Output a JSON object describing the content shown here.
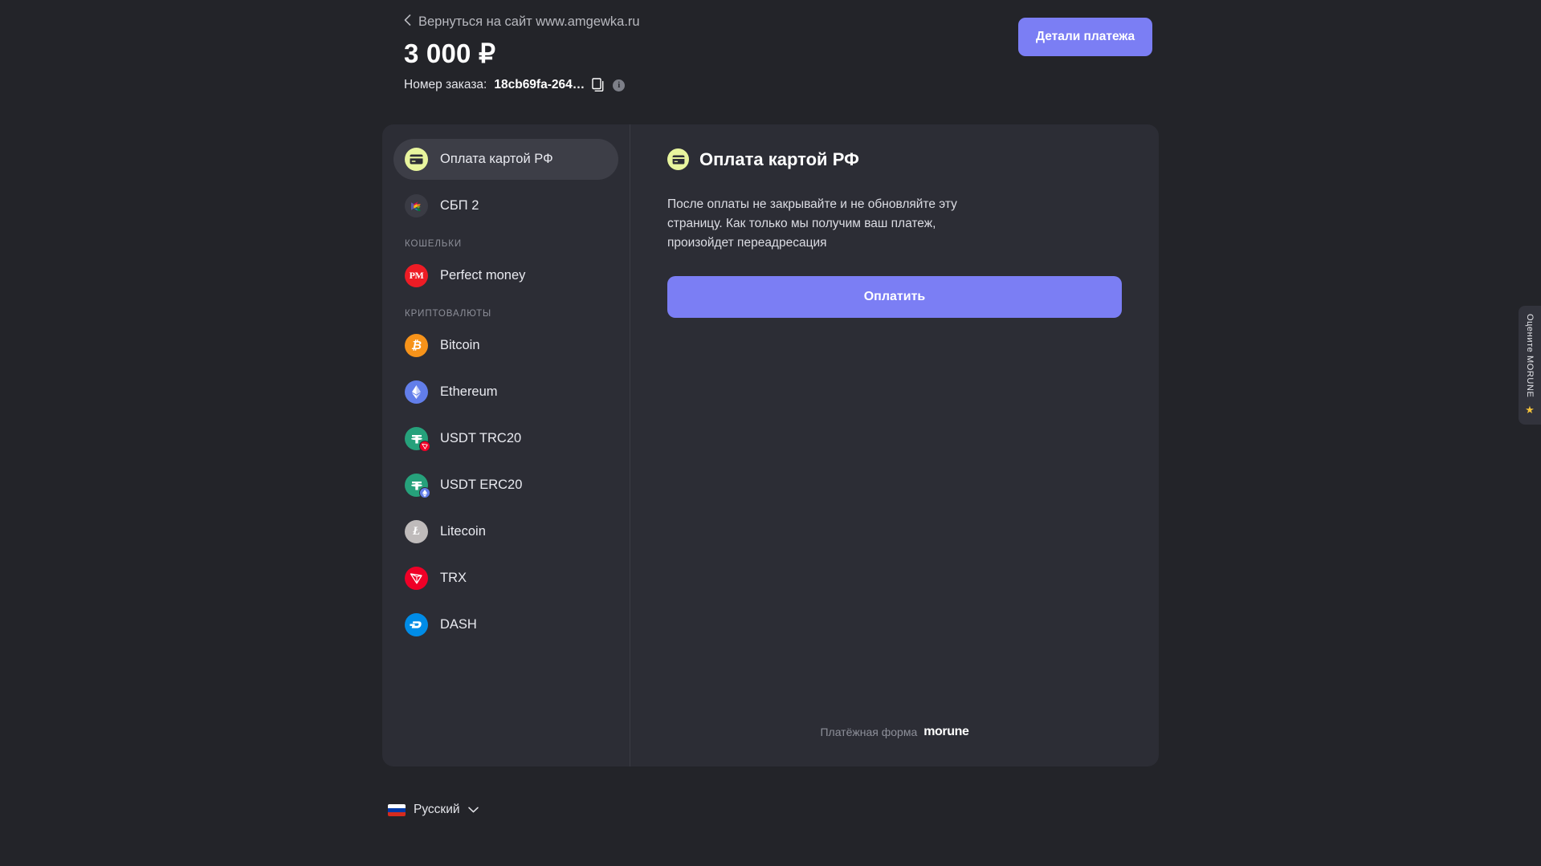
{
  "header": {
    "back_label": "Вернуться на сайт www.amgewka.ru",
    "amount": "3 000 ₽",
    "order_label": "Номер заказа:",
    "order_id": "18cb69fa-264…",
    "details_button": "Детали платежа"
  },
  "sidebar": {
    "methods": [
      {
        "label": "Оплата картой РФ",
        "icon": "card-icon",
        "selected": true
      },
      {
        "label": "СБП 2",
        "icon": "sbp-icon",
        "selected": false
      }
    ],
    "wallets_header": "КОШЕЛЬКИ",
    "wallets": [
      {
        "label": "Perfect money",
        "icon": "perfect-money-icon"
      }
    ],
    "crypto_header": "КРИПТОВАЛЮТЫ",
    "crypto": [
      {
        "label": "Bitcoin",
        "icon": "bitcoin-icon"
      },
      {
        "label": "Ethereum",
        "icon": "ethereum-icon"
      },
      {
        "label": "USDT TRC20",
        "icon": "usdt-icon",
        "badge": "tron-badge"
      },
      {
        "label": "USDT ERC20",
        "icon": "usdt-icon",
        "badge": "ethereum-badge"
      },
      {
        "label": "Litecoin",
        "icon": "litecoin-icon"
      },
      {
        "label": "TRX",
        "icon": "tron-icon"
      },
      {
        "label": "DASH",
        "icon": "dash-icon"
      }
    ]
  },
  "content": {
    "title": "Оплата картой РФ",
    "description": "После оплаты не закрывайте и не обновляйте эту страницу. Как только мы получим ваш платеж, произойдет переадресация",
    "pay_button": "Оплатить",
    "footer_text": "Платёжная форма",
    "brand": "morune"
  },
  "language": {
    "label": "Русский",
    "flag": "russia-flag-icon"
  },
  "rate_tab": {
    "label": "Оцените MORUNE",
    "star": "★"
  },
  "colors": {
    "page_bg": "#232429",
    "card_bg": "#2c2d35",
    "selected_bg": "#3d3e47",
    "accent": "#7b7ef4",
    "card_icon_bg": "#e8f59e",
    "bitcoin": "#f7931a",
    "ethereum": "#627eea",
    "usdt": "#26a17b",
    "litecoin": "#bfbbbb",
    "tron": "#ef0027",
    "dash": "#008ce7",
    "perfect_money": "#ee1c25",
    "star": "#f5c33b"
  }
}
